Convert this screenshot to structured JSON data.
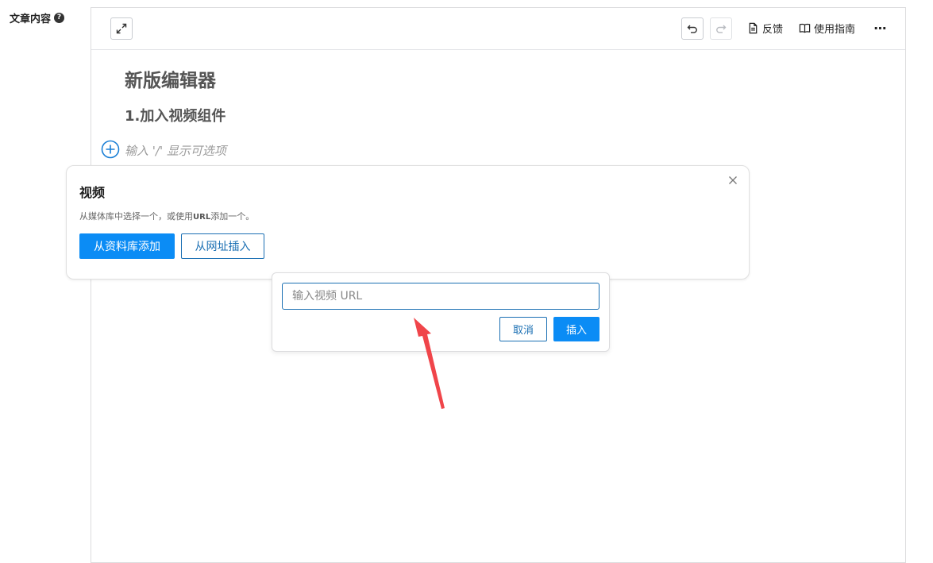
{
  "field": {
    "label": "文章内容",
    "help_icon": "question-circle-icon"
  },
  "toolbar": {
    "expand_icon": "expand-icon",
    "undo_icon": "undo-icon",
    "redo_icon": "redo-icon",
    "feedback_label": "反馈",
    "guide_label": "使用指南",
    "more_label": "⋯"
  },
  "content": {
    "heading1": "新版编辑器",
    "heading2": "1.加入视频组件",
    "placeholder": "输入 '/' 显示可选项"
  },
  "video_block": {
    "title": "视频",
    "desc_before": "从媒体库中选择一个，或使用",
    "desc_url": "URL",
    "desc_after": "添加一个。",
    "library_button": "从资料库添加",
    "url_button": "从网址插入"
  },
  "url_popover": {
    "input_placeholder": "输入视频 URL",
    "cancel_label": "取消",
    "insert_label": "插入"
  },
  "colors": {
    "primary": "#0b8cf5",
    "outline": "#1a6fb3",
    "annotation_arrow": "#f0454a"
  }
}
